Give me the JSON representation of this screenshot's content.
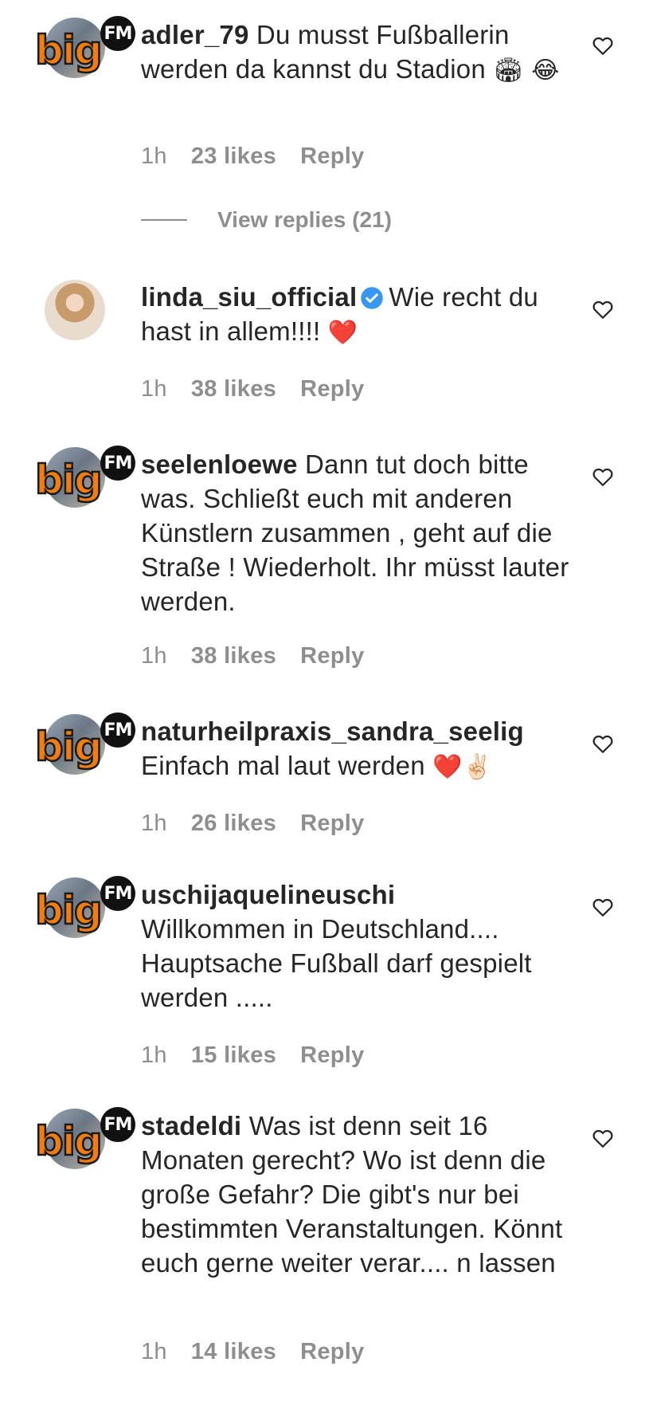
{
  "comments": [
    {
      "username": "adler_79",
      "text": "Du musst Fußballerin werden da kannst du Stadion",
      "emoji": "🏟 😂",
      "avatar": "bigfm-logo",
      "time": "1h",
      "likes": "23 likes",
      "reply": "Reply",
      "view_replies": "View replies (21)"
    },
    {
      "username": "linda_siu_official",
      "verified": true,
      "text": "Wie recht du hast in allem!!!!",
      "emoji": "❤️",
      "avatar": "profile-photo",
      "time": "1h",
      "likes": "38 likes",
      "reply": "Reply"
    },
    {
      "username": "seelenloewe",
      "text": "Dann tut doch bitte was. Schließt euch mit anderen Künstlern zusammen , geht auf die Straße ! Wiederholt. Ihr müsst lauter werden.",
      "avatar": "bigfm-logo",
      "time": "1h",
      "likes": "38 likes",
      "reply": "Reply"
    },
    {
      "username": "naturheilpraxis_sandra_seelig",
      "text": "Einfach mal laut werden",
      "emoji": "❤️✌🏻",
      "avatar": "bigfm-logo",
      "time": "1h",
      "likes": "26 likes",
      "reply": "Reply"
    },
    {
      "username": "uschijaquelineuschi",
      "text": "Willkommen in Deutschland.... Hauptsache Fußball darf gespielt werden .....",
      "avatar": "bigfm-logo",
      "time": "1h",
      "likes": "15 likes",
      "reply": "Reply"
    },
    {
      "username": "stadeldi",
      "text": "Was ist denn seit 16 Monaten gerecht? Wo ist denn die große Gefahr? Die gibt's nur bei bestimmten Veranstaltungen. Könnt euch gerne weiter verar.... n lassen",
      "avatar": "bigfm-logo",
      "time": "1h",
      "likes": "14 likes",
      "reply": "Reply"
    }
  ],
  "logo": {
    "big": "big",
    "fm": "FM"
  },
  "icons": {
    "like": "heart-outline-icon",
    "verified": "verified-badge-icon"
  },
  "colors": {
    "text": "#262626",
    "meta": "#8e8e8e",
    "verified": "#3897f0",
    "heart_emoji": "#e0245e",
    "logo_orange": "#f07d0f"
  }
}
